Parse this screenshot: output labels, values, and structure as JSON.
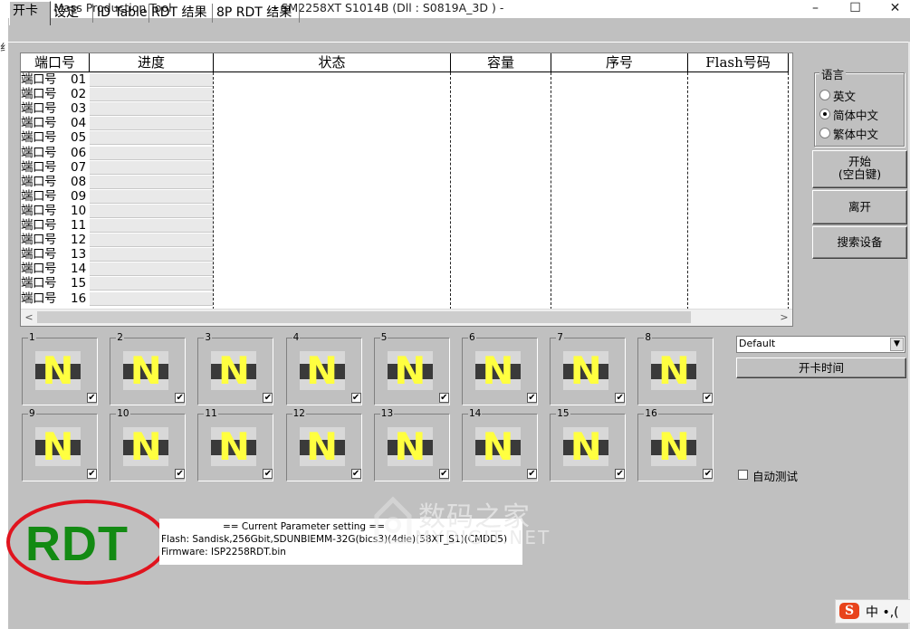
{
  "window": {
    "title": "SMI Mass Production Tool",
    "model_info": "- SM2258XT     S1014B      (Dll : S0819A_3D ) -",
    "min_glyph": "–",
    "max_glyph": "☐",
    "close_glyph": "✕"
  },
  "left_edge_glyph": "纟",
  "tabs": [
    {
      "label": "开卡"
    },
    {
      "label": "设定"
    },
    {
      "label": "ID Table"
    },
    {
      "label": "RDT 结果"
    },
    {
      "label": "8P RDT 结果"
    }
  ],
  "grid": {
    "headers": [
      "端口号",
      "进度",
      "状态",
      "容量",
      "序号",
      "Flash号码"
    ],
    "rows": [
      {
        "label": "端口号",
        "num": "01"
      },
      {
        "label": "端口号",
        "num": "02"
      },
      {
        "label": "端口号",
        "num": "03"
      },
      {
        "label": "端口号",
        "num": "04"
      },
      {
        "label": "端口号",
        "num": "05"
      },
      {
        "label": "端口号",
        "num": "06"
      },
      {
        "label": "端口号",
        "num": "07"
      },
      {
        "label": "端口号",
        "num": "08"
      },
      {
        "label": "端口号",
        "num": "09"
      },
      {
        "label": "端口号",
        "num": "10"
      },
      {
        "label": "端口号",
        "num": "11"
      },
      {
        "label": "端口号",
        "num": "12"
      },
      {
        "label": "端口号",
        "num": "13"
      },
      {
        "label": "端口号",
        "num": "14"
      },
      {
        "label": "端口号",
        "num": "15"
      },
      {
        "label": "端口号",
        "num": "16"
      }
    ],
    "scroll_left": "<",
    "scroll_right": ">"
  },
  "language": {
    "title": "语言",
    "options": [
      {
        "label": "英文",
        "selected": false
      },
      {
        "label": "简体中文",
        "selected": true
      },
      {
        "label": "繁体中文",
        "selected": false
      }
    ]
  },
  "buttons": {
    "start_line1": "开始",
    "start_line2": "(空白键)",
    "exit": "离开",
    "search": "搜索设备",
    "open_time": "开卡时间"
  },
  "slots": [
    {
      "num": "1",
      "icon": "N",
      "checked": true
    },
    {
      "num": "2",
      "icon": "N",
      "checked": true
    },
    {
      "num": "3",
      "icon": "N",
      "checked": true
    },
    {
      "num": "4",
      "icon": "N",
      "checked": true
    },
    {
      "num": "5",
      "icon": "N",
      "checked": true
    },
    {
      "num": "6",
      "icon": "N",
      "checked": true
    },
    {
      "num": "7",
      "icon": "N",
      "checked": true
    },
    {
      "num": "8",
      "icon": "N",
      "checked": true
    },
    {
      "num": "9",
      "icon": "N",
      "checked": true
    },
    {
      "num": "10",
      "icon": "N",
      "checked": true
    },
    {
      "num": "11",
      "icon": "N",
      "checked": true
    },
    {
      "num": "12",
      "icon": "N",
      "checked": true
    },
    {
      "num": "13",
      "icon": "N",
      "checked": true
    },
    {
      "num": "14",
      "icon": "N",
      "checked": true
    },
    {
      "num": "15",
      "icon": "N",
      "checked": true
    },
    {
      "num": "16",
      "icon": "N",
      "checked": true
    }
  ],
  "dropdown": {
    "value": "Default",
    "arrow": "▼"
  },
  "auto_test": {
    "label": "自动测试",
    "checked": false
  },
  "mode_label": "RDT",
  "params": {
    "title": "== Current Parameter setting ==",
    "flash": "Flash:   Sandisk,256Gbit,SDUNBIEMM-32G(bics3)(4die)(58XT_S1)(CMDD5)",
    "firmware": "Firmware:   ISP2258RDT.bin"
  },
  "watermark": {
    "main": "数码之家",
    "sub": "MYDIGIT.NET"
  },
  "ime": {
    "logo": "S",
    "text": "中 •,("
  },
  "colors": {
    "rdt_green": "#138a13",
    "annotation_red": "#e0141e",
    "slot_icon_yellow": "#ffff40"
  }
}
